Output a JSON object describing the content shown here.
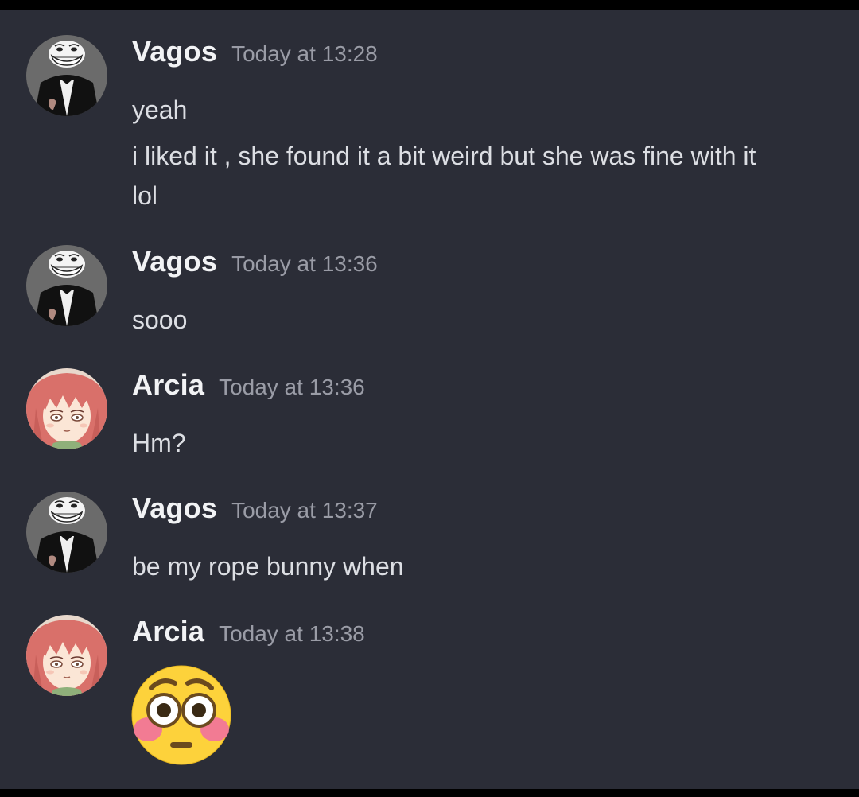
{
  "messages": [
    {
      "author": "Vagos",
      "timestamp": "Today at 13:28",
      "avatar": "trollface-suit-avatar",
      "lines": [
        "yeah",
        "i liked it , she found it a bit weird but she was fine with it",
        "lol"
      ]
    },
    {
      "author": "Vagos",
      "timestamp": "Today at 13:36",
      "avatar": "trollface-suit-avatar",
      "lines": [
        "sooo"
      ]
    },
    {
      "author": "Arcia",
      "timestamp": "Today at 13:36",
      "avatar": "anime-girl-avatar",
      "lines": [
        "Hm?"
      ]
    },
    {
      "author": "Vagos",
      "timestamp": "Today at 13:37",
      "avatar": "trollface-suit-avatar",
      "lines": [
        "be my rope bunny when"
      ]
    },
    {
      "author": "Arcia",
      "timestamp": "Today at 13:38",
      "avatar": "anime-girl-avatar",
      "emoji": "flushed-face-emoji"
    }
  ],
  "colors": {
    "background": "#2b2d37",
    "username": "#f2f3f5",
    "timestamp": "#9a9ca6",
    "message_text": "#dcdee3"
  }
}
